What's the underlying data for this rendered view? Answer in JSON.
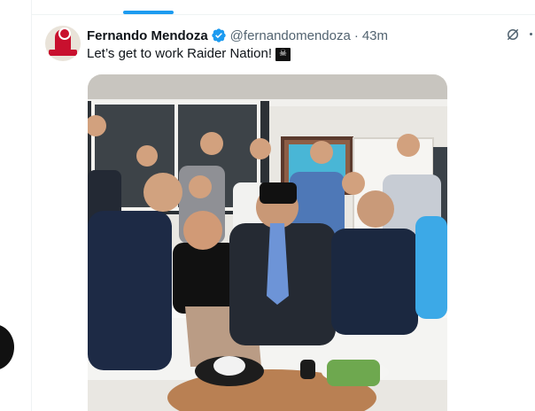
{
  "tweet": {
    "display_name": "Fernando Mendoza",
    "handle": "@fernandomendoza",
    "separator": "·",
    "time": "43m",
    "text": "Let’s get to work Raider Nation!",
    "emoji_icon": "pirate-flag-icon"
  },
  "colors": {
    "accent": "#1d9bf0",
    "text": "#0f1419",
    "muted": "#536471"
  }
}
